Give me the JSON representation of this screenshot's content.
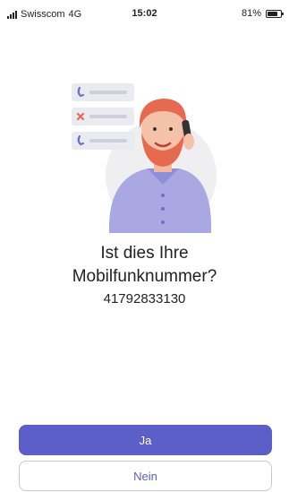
{
  "status_bar": {
    "carrier": "Swisscom",
    "network": "4G",
    "time": "15:02",
    "battery_percent": "81%",
    "battery_level": 0.81
  },
  "illustration": {
    "icons": [
      "phone-icon",
      "missed-call-icon",
      "phone-icon"
    ]
  },
  "prompt": {
    "title_line_1": "Ist dies Ihre",
    "title_line_2": "Mobilfunknummer?",
    "phone_number": "41792833130"
  },
  "buttons": {
    "yes_label": "Ja",
    "no_label": "Nein"
  },
  "colors": {
    "accent": "#5b5fc7",
    "hair": "#e56a4f",
    "shirt": "#a9a8e2",
    "card": "#eaeaf1"
  }
}
